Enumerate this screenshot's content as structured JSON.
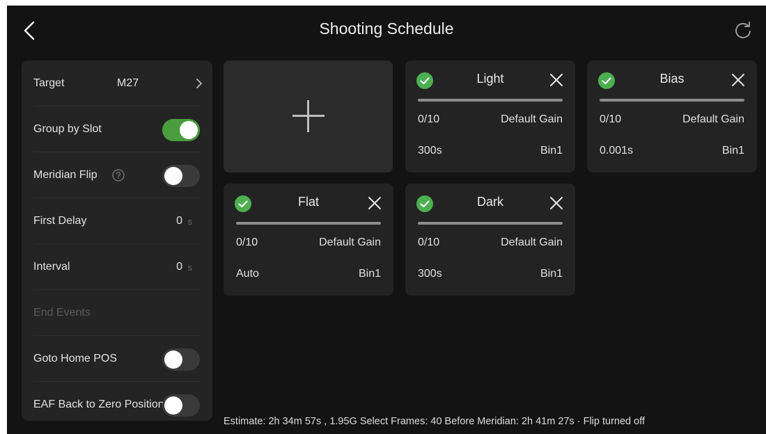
{
  "header": {
    "title": "Shooting Schedule",
    "back_icon": "chevron-left-icon",
    "refresh_icon": "refresh-icon"
  },
  "sidebar": {
    "target": {
      "label": "Target",
      "value": "M27"
    },
    "group_by_slot": {
      "label": "Group by Slot",
      "on": true
    },
    "meridian_flip": {
      "label": "Meridian Flip",
      "on": false
    },
    "first_delay": {
      "label": "First Delay",
      "value": "0",
      "unit": "s"
    },
    "interval": {
      "label": "Interval",
      "value": "0",
      "unit": "s"
    },
    "end_events": {
      "label": "End Events"
    },
    "goto_home": {
      "label": "Goto Home POS",
      "on": false
    },
    "eaf_back": {
      "label": "EAF Back to Zero Position",
      "on": false
    }
  },
  "cards": {
    "light": {
      "title": "Light",
      "frames": "0/10",
      "gain": "Default Gain",
      "exposure": "300s",
      "bin": "Bin1"
    },
    "bias": {
      "title": "Bias",
      "frames": "0/10",
      "gain": "Default Gain",
      "exposure": "0.001s",
      "bin": "Bin1"
    },
    "flat": {
      "title": "Flat",
      "frames": "0/10",
      "gain": "Default Gain",
      "exposure": "Auto",
      "bin": "Bin1"
    },
    "dark": {
      "title": "Dark",
      "frames": "0/10",
      "gain": "Default Gain",
      "exposure": "300s",
      "bin": "Bin1"
    }
  },
  "footer": {
    "summary": "Estimate: 2h 34m 57s , 1.95G   Select Frames: 40   Before Meridian: 2h 41m 27s  ·  Flip turned off"
  },
  "colors": {
    "background": "#131313",
    "panel": "#242424",
    "toggle_on": "#4a9d3d",
    "check": "#4caf50"
  }
}
